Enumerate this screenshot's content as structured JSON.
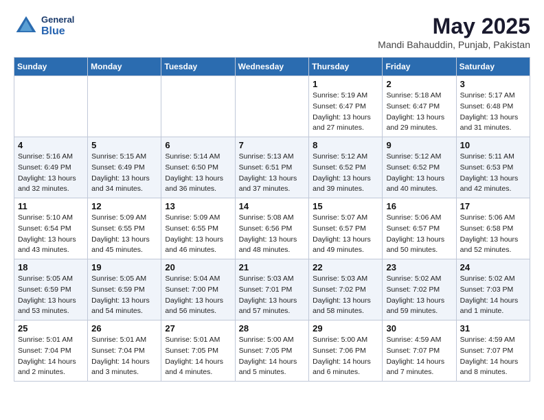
{
  "header": {
    "logo": {
      "line1": "General",
      "line2": "Blue"
    },
    "title": "May 2025",
    "location": "Mandi Bahauddin, Punjab, Pakistan"
  },
  "days_of_week": [
    "Sunday",
    "Monday",
    "Tuesday",
    "Wednesday",
    "Thursday",
    "Friday",
    "Saturday"
  ],
  "weeks": [
    [
      {
        "day": "",
        "info": ""
      },
      {
        "day": "",
        "info": ""
      },
      {
        "day": "",
        "info": ""
      },
      {
        "day": "",
        "info": ""
      },
      {
        "day": "1",
        "info": "Sunrise: 5:19 AM\nSunset: 6:47 PM\nDaylight: 13 hours\nand 27 minutes."
      },
      {
        "day": "2",
        "info": "Sunrise: 5:18 AM\nSunset: 6:47 PM\nDaylight: 13 hours\nand 29 minutes."
      },
      {
        "day": "3",
        "info": "Sunrise: 5:17 AM\nSunset: 6:48 PM\nDaylight: 13 hours\nand 31 minutes."
      }
    ],
    [
      {
        "day": "4",
        "info": "Sunrise: 5:16 AM\nSunset: 6:49 PM\nDaylight: 13 hours\nand 32 minutes."
      },
      {
        "day": "5",
        "info": "Sunrise: 5:15 AM\nSunset: 6:49 PM\nDaylight: 13 hours\nand 34 minutes."
      },
      {
        "day": "6",
        "info": "Sunrise: 5:14 AM\nSunset: 6:50 PM\nDaylight: 13 hours\nand 36 minutes."
      },
      {
        "day": "7",
        "info": "Sunrise: 5:13 AM\nSunset: 6:51 PM\nDaylight: 13 hours\nand 37 minutes."
      },
      {
        "day": "8",
        "info": "Sunrise: 5:12 AM\nSunset: 6:52 PM\nDaylight: 13 hours\nand 39 minutes."
      },
      {
        "day": "9",
        "info": "Sunrise: 5:12 AM\nSunset: 6:52 PM\nDaylight: 13 hours\nand 40 minutes."
      },
      {
        "day": "10",
        "info": "Sunrise: 5:11 AM\nSunset: 6:53 PM\nDaylight: 13 hours\nand 42 minutes."
      }
    ],
    [
      {
        "day": "11",
        "info": "Sunrise: 5:10 AM\nSunset: 6:54 PM\nDaylight: 13 hours\nand 43 minutes."
      },
      {
        "day": "12",
        "info": "Sunrise: 5:09 AM\nSunset: 6:55 PM\nDaylight: 13 hours\nand 45 minutes."
      },
      {
        "day": "13",
        "info": "Sunrise: 5:09 AM\nSunset: 6:55 PM\nDaylight: 13 hours\nand 46 minutes."
      },
      {
        "day": "14",
        "info": "Sunrise: 5:08 AM\nSunset: 6:56 PM\nDaylight: 13 hours\nand 48 minutes."
      },
      {
        "day": "15",
        "info": "Sunrise: 5:07 AM\nSunset: 6:57 PM\nDaylight: 13 hours\nand 49 minutes."
      },
      {
        "day": "16",
        "info": "Sunrise: 5:06 AM\nSunset: 6:57 PM\nDaylight: 13 hours\nand 50 minutes."
      },
      {
        "day": "17",
        "info": "Sunrise: 5:06 AM\nSunset: 6:58 PM\nDaylight: 13 hours\nand 52 minutes."
      }
    ],
    [
      {
        "day": "18",
        "info": "Sunrise: 5:05 AM\nSunset: 6:59 PM\nDaylight: 13 hours\nand 53 minutes."
      },
      {
        "day": "19",
        "info": "Sunrise: 5:05 AM\nSunset: 6:59 PM\nDaylight: 13 hours\nand 54 minutes."
      },
      {
        "day": "20",
        "info": "Sunrise: 5:04 AM\nSunset: 7:00 PM\nDaylight: 13 hours\nand 56 minutes."
      },
      {
        "day": "21",
        "info": "Sunrise: 5:03 AM\nSunset: 7:01 PM\nDaylight: 13 hours\nand 57 minutes."
      },
      {
        "day": "22",
        "info": "Sunrise: 5:03 AM\nSunset: 7:02 PM\nDaylight: 13 hours\nand 58 minutes."
      },
      {
        "day": "23",
        "info": "Sunrise: 5:02 AM\nSunset: 7:02 PM\nDaylight: 13 hours\nand 59 minutes."
      },
      {
        "day": "24",
        "info": "Sunrise: 5:02 AM\nSunset: 7:03 PM\nDaylight: 14 hours\nand 1 minute."
      }
    ],
    [
      {
        "day": "25",
        "info": "Sunrise: 5:01 AM\nSunset: 7:04 PM\nDaylight: 14 hours\nand 2 minutes."
      },
      {
        "day": "26",
        "info": "Sunrise: 5:01 AM\nSunset: 7:04 PM\nDaylight: 14 hours\nand 3 minutes."
      },
      {
        "day": "27",
        "info": "Sunrise: 5:01 AM\nSunset: 7:05 PM\nDaylight: 14 hours\nand 4 minutes."
      },
      {
        "day": "28",
        "info": "Sunrise: 5:00 AM\nSunset: 7:05 PM\nDaylight: 14 hours\nand 5 minutes."
      },
      {
        "day": "29",
        "info": "Sunrise: 5:00 AM\nSunset: 7:06 PM\nDaylight: 14 hours\nand 6 minutes."
      },
      {
        "day": "30",
        "info": "Sunrise: 4:59 AM\nSunset: 7:07 PM\nDaylight: 14 hours\nand 7 minutes."
      },
      {
        "day": "31",
        "info": "Sunrise: 4:59 AM\nSunset: 7:07 PM\nDaylight: 14 hours\nand 8 minutes."
      }
    ]
  ]
}
